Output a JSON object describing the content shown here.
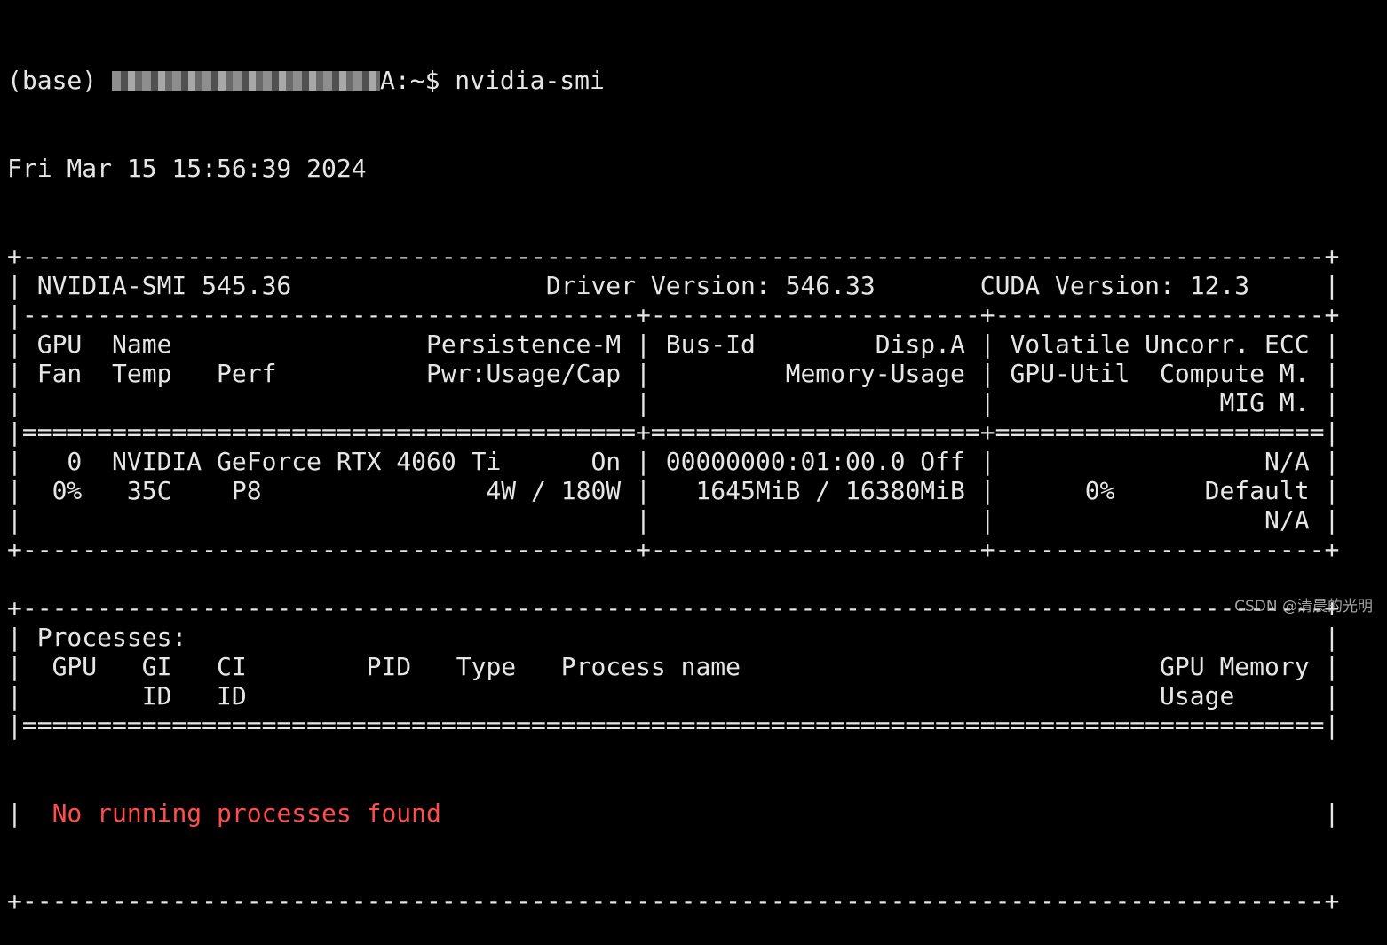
{
  "terminal": {
    "prompt_env": "(base) ",
    "prompt_suffix": "A:~$ nvidia-smi",
    "timestamp": "Fri Mar 15 15:56:39 2024"
  },
  "smi": {
    "lines": [
      "+---------------------------------------------------------------------------------------+",
      "| NVIDIA-SMI 545.36                 Driver Version: 546.33       CUDA Version: 12.3     |",
      "|-----------------------------------------+----------------------+----------------------+",
      "| GPU  Name                 Persistence-M | Bus-Id        Disp.A | Volatile Uncorr. ECC |",
      "| Fan  Temp   Perf          Pwr:Usage/Cap |         Memory-Usage | GPU-Util  Compute M. |",
      "|                                         |                      |               MIG M. |",
      "|=========================================+======================+======================|",
      "|   0  NVIDIA GeForce RTX 4060 Ti      On | 00000000:01:00.0 Off |                  N/A |",
      "|  0%   35C    P8               4W / 180W |   1645MiB / 16380MiB |      0%      Default |",
      "|                                         |                      |                  N/A |",
      "+-----------------------------------------+----------------------+----------------------+",
      "",
      "+---------------------------------------------------------------------------------------+",
      "| Processes:                                                                            |",
      "|  GPU   GI   CI        PID   Type   Process name                            GPU Memory |",
      "|        ID   ID                                                             Usage      |",
      "|=======================================================================================|"
    ],
    "no_process_prefix": "|  ",
    "no_process_message": "No running processes found",
    "no_process_suffix": "                                                           |",
    "footer": "+---------------------------------------------------------------------------------------+"
  },
  "watermark": "CSDN @清晨的光明",
  "colors": {
    "background": "#000000",
    "text": "#e6e6e6",
    "error": "#ff4d4d"
  }
}
